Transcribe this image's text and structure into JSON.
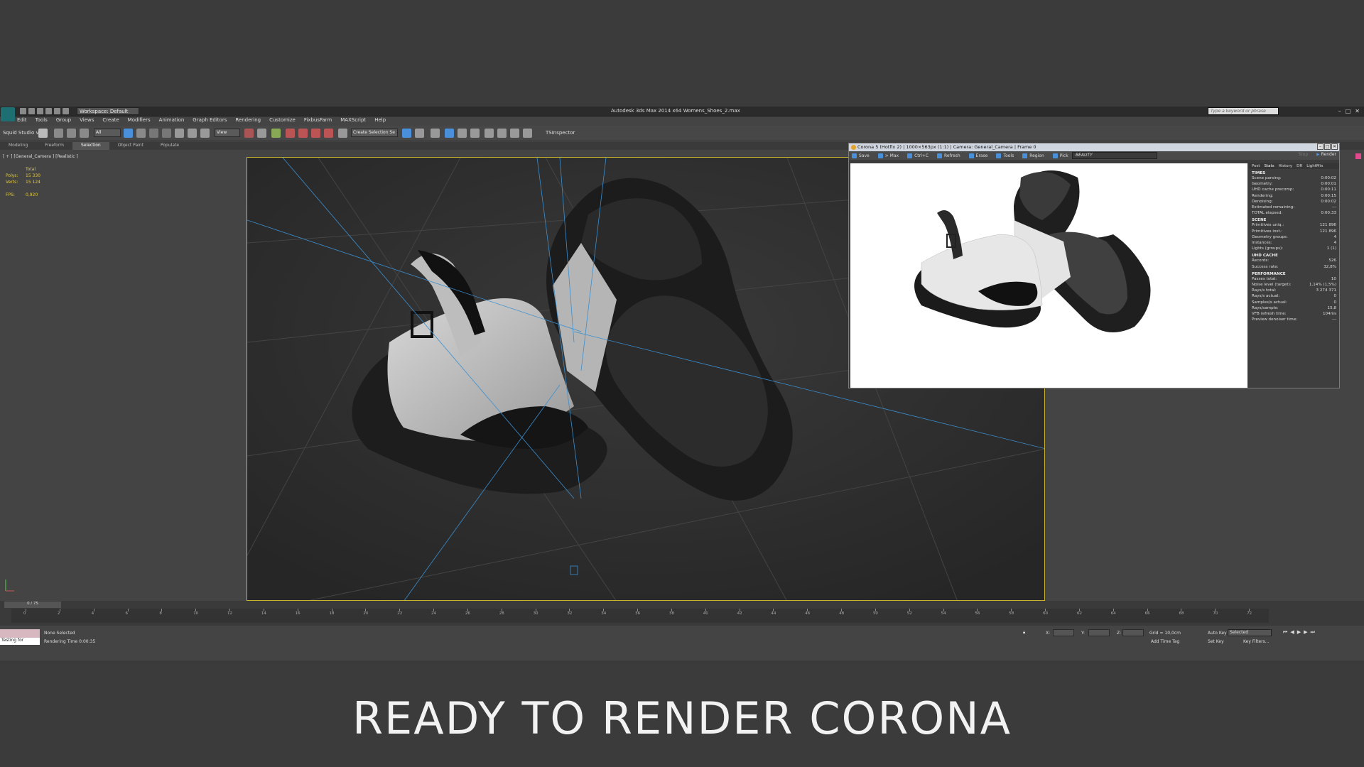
{
  "app": {
    "title": "Autodesk 3ds Max  2014 x64     Womens_Shoes_2.max",
    "workspace": "Workspace: Default",
    "search_placeholder": "Type a keyword or phrase"
  },
  "menu": [
    "Edit",
    "Tools",
    "Group",
    "Views",
    "Create",
    "Modifiers",
    "Animation",
    "Graph Editors",
    "Rendering",
    "Customize",
    "FixbusFarm",
    "MAXScript",
    "Help"
  ],
  "toolbar": {
    "squid": "Squid Studio v",
    "filter_all": "All",
    "view": "View",
    "create_selection_set": "Create Selection Se",
    "tsinspector": "TSInspector"
  },
  "ribbon_tabs": [
    "Modeling",
    "Freeform",
    "Selection",
    "Object Paint",
    "Populate"
  ],
  "ribbon_active": "Selection",
  "viewport": {
    "label": "[ + ] [General_Camera ] [Realistic ]",
    "stats": {
      "total_label": "Total",
      "polys_label": "Polys:",
      "polys": "15 330",
      "verts_label": "Verts:",
      "verts": "15 124",
      "fps_label": "FPS:",
      "fps": "0,920"
    }
  },
  "corona": {
    "title": "Corona 5 (Hotfix 2) | 1000×563px (1:1) | Camera: General_Camera | Frame 0",
    "tools": [
      "Save",
      "> Max",
      "Ctrl+C",
      "Refresh",
      "Erase",
      "Tools",
      "Region",
      "Pick"
    ],
    "beauty": "BEAUTY",
    "stop": "Stop",
    "render": "Render",
    "tabs": [
      "Post",
      "Stats",
      "History",
      "DR",
      "LightMix"
    ],
    "active_tab": "Stats",
    "sections": [
      {
        "title": "TIMES",
        "rows": [
          [
            "Scene parsing:",
            "0:00:02"
          ],
          [
            "Geometry:",
            "0:00:01"
          ],
          [
            "UHD cache precomp:",
            "0:00:11"
          ],
          [
            "Rendering:",
            "0:00:15"
          ],
          [
            "Denoising:",
            "0:00:02"
          ],
          [
            "Estimated remaining:",
            "---"
          ],
          [
            "TOTAL elapsed:",
            "0:00:33"
          ]
        ]
      },
      {
        "title": "SCENE",
        "rows": [
          [
            "Primitives uniq.:",
            "121 896"
          ],
          [
            "Primitives inst.:",
            "121 896"
          ],
          [
            "Geometry groups:",
            "4"
          ],
          [
            "Instances:",
            "4"
          ],
          [
            "Lights (groups):",
            "1 (1)"
          ]
        ]
      },
      {
        "title": "UHD CACHE",
        "rows": [
          [
            "Records:",
            "526"
          ],
          [
            "Success rate:",
            "32,8%"
          ]
        ]
      },
      {
        "title": "PERFORMANCE",
        "rows": [
          [
            "Passes total:",
            "10"
          ],
          [
            "Noise level (target):",
            "1,14% (1,5%)"
          ],
          [
            "Rays/s total:",
            "3 274 371"
          ],
          [
            "Rays/s actual:",
            "0"
          ],
          [
            "Samples/s actual:",
            "0"
          ],
          [
            "Rays/sample:",
            "15,8"
          ],
          [
            "VFB refresh time:",
            "104ms"
          ],
          [
            "Preview denoiser time:",
            "---"
          ]
        ]
      }
    ]
  },
  "timeline": {
    "counter": "0 / 75",
    "ticks": [
      "0",
      "2",
      "4",
      "6",
      "8",
      "10",
      "12",
      "14",
      "16",
      "18",
      "20",
      "22",
      "24",
      "26",
      "28",
      "30",
      "32",
      "34",
      "36",
      "38",
      "40",
      "42",
      "44",
      "46",
      "48",
      "50",
      "52",
      "54",
      "56",
      "58",
      "60",
      "62",
      "64",
      "66",
      "68",
      "70",
      "72"
    ]
  },
  "status": {
    "selection": "None Selected",
    "render_time": "Rendering Time  0:00:35",
    "maxscript": "Testing for",
    "x_label": "X:",
    "y_label": "Y:",
    "z_label": "Z:",
    "grid": "Grid = 10,0cm",
    "add_time_tag": "Add Time Tag",
    "auto_key": "Auto Key",
    "selected": "Selected",
    "set_key": "Set Key",
    "key_filters": "Key Filters..."
  },
  "caption": "READY TO RENDER  CORONA",
  "colors": {
    "viewport_border": "#c9b42e",
    "stats_text": "#e0c94a",
    "accent_blue": "#4a8fd9"
  }
}
